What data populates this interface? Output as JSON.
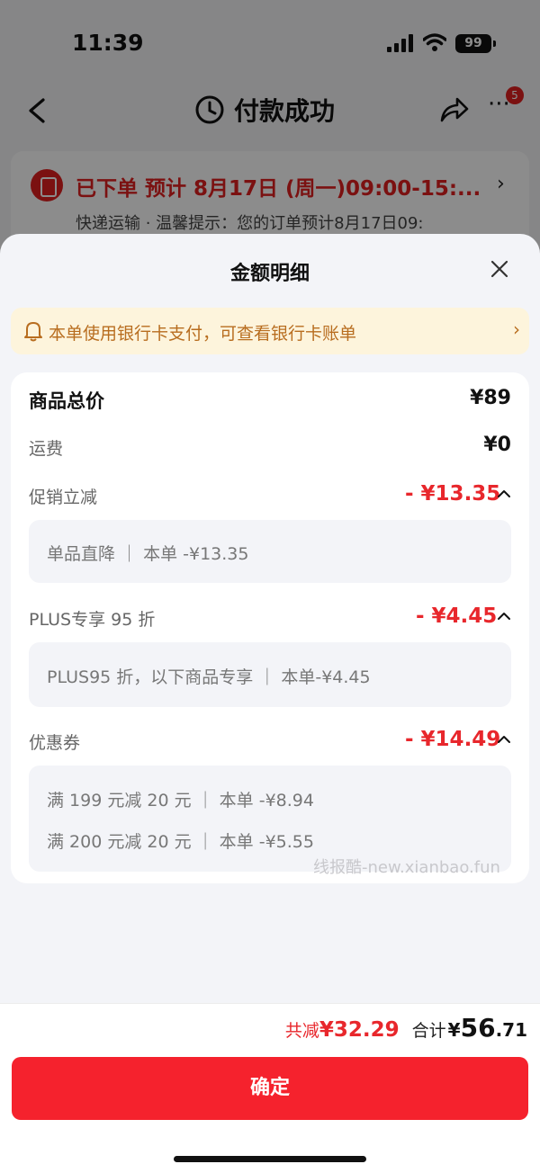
{
  "status_bar": {
    "time": "11:39",
    "battery": "99"
  },
  "nav": {
    "title": "付款成功",
    "more_badge": "5"
  },
  "order": {
    "title": "已下单 预计 8月17日 (周一)09:00-15:...",
    "subtitle": "快递运输 · 温馨提示：您的订单预计8月17日09:"
  },
  "sheet": {
    "title": "金额明细",
    "notice": "本单使用银行卡支付，可查看银行卡账单"
  },
  "details": {
    "goods_total": {
      "label": "商品总价",
      "value": "¥89"
    },
    "shipping": {
      "label": "运费",
      "value": "¥0"
    },
    "promo": {
      "label": "促销立减",
      "value": "- ¥13.35",
      "items": [
        "单品直降 ｜ 本单 -¥13.35"
      ]
    },
    "plus": {
      "label": "PLUS专享 95 折",
      "value": "- ¥4.45",
      "items": [
        "PLUS95 折，以下商品专享 ｜ 本单-¥4.45"
      ]
    },
    "coupon": {
      "label": "优惠券",
      "value": "- ¥14.49",
      "items": [
        "满 199 元减 20 元 ｜ 本单 -¥8.94",
        "满 200 元减 20 元 ｜ 本单 -¥5.55"
      ]
    }
  },
  "watermark": "线报酷-new.xianbao.fun",
  "footer": {
    "saved_label": "共减",
    "saved_value": "¥32.29",
    "total_label": "合计",
    "total_symbol": "¥",
    "total_int": "56",
    "total_dec": ".71",
    "confirm_label": "确定"
  },
  "colors": {
    "accent_red": "#e8272c",
    "button_red": "#f5222d",
    "notice_bg": "#fdf4dc",
    "notice_text": "#b86d1f"
  }
}
